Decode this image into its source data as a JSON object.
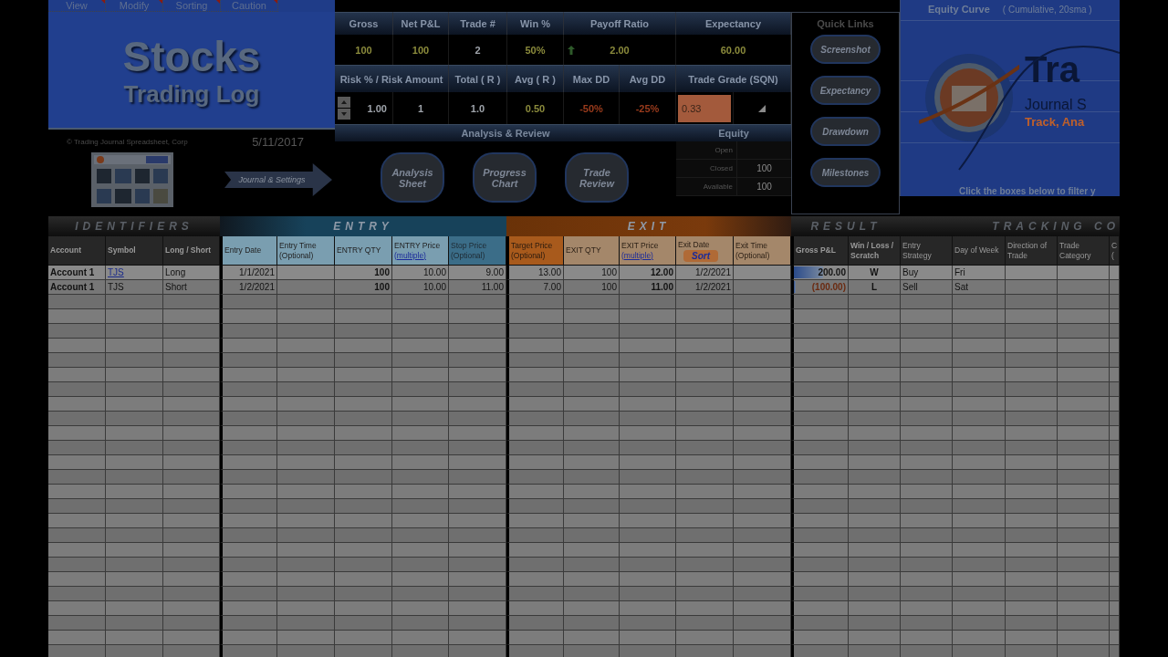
{
  "menu": [
    {
      "label": "View",
      "comment": true
    },
    {
      "label": "Modify",
      "comment": true
    },
    {
      "label": "Sorting",
      "comment": true
    },
    {
      "label": "Caution",
      "comment": true
    }
  ],
  "title": {
    "main": "Stocks",
    "sub": "Trading Log"
  },
  "copyright": "© Trading Journal Spreadsheet, Corp",
  "date": "5/11/2017",
  "journal_button": "Journal & Settings",
  "stats": {
    "headers1": [
      "Gross",
      "Net P&L",
      "Trade #",
      "Win %",
      "Payoff Ratio",
      "Expectancy"
    ],
    "values1": [
      {
        "kind": "positive",
        "value": "100"
      },
      {
        "kind": "positive",
        "value": "100"
      },
      {
        "kind": "neutral",
        "value": "2"
      },
      {
        "kind": "positive",
        "value": "50%"
      },
      {
        "kind": "positive",
        "value": "2.00"
      },
      {
        "kind": "positive",
        "value": "60.00"
      }
    ],
    "headers2": [
      "Risk %  /  Risk Amount",
      "Total ( R )",
      "Avg ( R )",
      "Max DD",
      "Avg DD",
      "Trade Grade (SQN)"
    ],
    "values2": [
      {
        "kind": "spinner",
        "value": "1.00"
      },
      {
        "kind": "neutral",
        "value": "1"
      },
      {
        "kind": "neutral",
        "value": "1.0"
      },
      {
        "kind": "positive",
        "value": "0.50"
      },
      {
        "kind": "negative",
        "value": "-50%"
      },
      {
        "kind": "negative",
        "value": "-25%"
      },
      {
        "kind": "grade",
        "value": "0.33"
      },
      {
        "kind": "signal"
      }
    ]
  },
  "analysis": {
    "title": "Analysis & Review",
    "buttons": [
      "Analysis Sheet",
      "Progress Chart",
      "Trade Review"
    ]
  },
  "equity": {
    "title": "Equity",
    "rows": [
      {
        "label": "Open"
      },
      {
        "label": "Closed",
        "value": "100"
      },
      {
        "label": "Available",
        "value": "100"
      }
    ]
  },
  "quick_links": {
    "title": "Quick Links",
    "buttons": [
      "Screenshot",
      "Expectancy",
      "Drawdown",
      "Milestones"
    ]
  },
  "equity_curve": {
    "title": "Equity Curve",
    "subtitle": "( Cumulative,  20sma )",
    "logo_big": "Tra",
    "logo_line": "Journal S",
    "logo_tagline": "Track, Ana",
    "note": "Click the boxes below to filter y"
  },
  "sections": [
    {
      "label": "IDENTIFIERS",
      "kind": "identifiers"
    },
    {
      "label": "ENTRY",
      "kind": "entry"
    },
    {
      "label": "EXIT",
      "kind": "exit"
    },
    {
      "label": "RESULT",
      "kind": "result"
    },
    {
      "label": "TRACKING CO",
      "kind": "tracking"
    }
  ],
  "columns": [
    {
      "label": "Account",
      "kind": "identifiers"
    },
    {
      "label": "Symbol",
      "kind": "identifiers"
    },
    {
      "label": "Long / Short",
      "kind": "identifiers"
    },
    {
      "label": "Entry Date",
      "kind": "entry"
    },
    {
      "label": "Entry Time",
      "note": "(Optional)",
      "kind": "entry"
    },
    {
      "label": "ENTRY QTY",
      "kind": "entry"
    },
    {
      "label": "ENTRY Price",
      "link": "(multiple)",
      "kind": "entry"
    },
    {
      "label": "Stop Price",
      "note": "(Optional)",
      "kind": "stop"
    },
    {
      "label": "Target Price",
      "note": "(Optional)",
      "kind": "target"
    },
    {
      "label": "EXIT QTY",
      "kind": "exit"
    },
    {
      "label": "EXIT Price",
      "link": "(multiple)",
      "kind": "exit"
    },
    {
      "label": "Exit Date",
      "button": "Sort",
      "kind": "exit"
    },
    {
      "label": "Exit Time",
      "note": "(Optional)",
      "kind": "exit"
    },
    {
      "label": "Gross P&L",
      "kind": "result"
    },
    {
      "label": "Win / Loss /",
      "note": "Scratch",
      "kind": "result"
    },
    {
      "label": "Entry",
      "note": "Strategy",
      "kind": "tracking"
    },
    {
      "label": "Day of Week",
      "kind": "tracking"
    },
    {
      "label": "Direction of",
      "note": "Trade",
      "kind": "tracking"
    },
    {
      "label": "Trade",
      "note": "Category",
      "kind": "tracking"
    },
    {
      "label": "C",
      "note": "(",
      "kind": "tracking"
    }
  ],
  "rows": [
    {
      "cells": [
        "Account 1",
        "TJS",
        "Long",
        "1/1/2021",
        null,
        "100",
        "10.00",
        "9.00",
        "13.00",
        "100",
        "12.00",
        "1/2/2021",
        null,
        "200.00",
        "W",
        "Buy",
        "Fri",
        null,
        null,
        null
      ],
      "symbol_link": true,
      "loss": false,
      "level": 0.55
    },
    {
      "cells": [
        "Account 1",
        "TJS",
        "Short",
        "1/2/2021",
        null,
        "100",
        "10.00",
        "11.00",
        "7.00",
        "100",
        "11.00",
        "1/2/2021",
        null,
        "(100.00)",
        "L",
        "Sell",
        "Sat",
        null,
        null,
        null
      ],
      "symbol_link": false,
      "loss": true,
      "level": 0.04
    }
  ]
}
